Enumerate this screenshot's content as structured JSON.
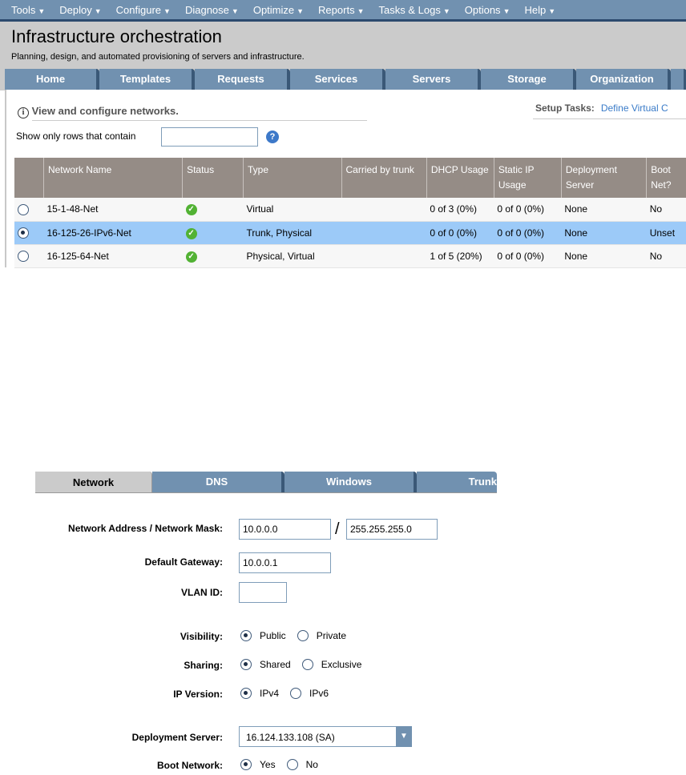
{
  "menu": [
    "Tools",
    "Deploy",
    "Configure",
    "Diagnose",
    "Optimize",
    "Reports",
    "Tasks & Logs",
    "Options",
    "Help"
  ],
  "header": {
    "title": "Infrastructure orchestration",
    "subtitle": "Planning, design, and automated provisioning of servers and infrastructure."
  },
  "main_tabs": [
    "Home",
    "Templates",
    "Requests",
    "Services",
    "Servers",
    "Storage",
    "Organization",
    ""
  ],
  "info": "View and configure networks.",
  "setup": {
    "label": "Setup Tasks:",
    "link": "Define Virtual C"
  },
  "filter": {
    "label": "Show only rows that contain",
    "value": "",
    "help": "?"
  },
  "table": {
    "columns": [
      "",
      "Network Name",
      "Status",
      "Type",
      "Carried by trunk",
      "DHCP Usage",
      "Static IP Usage",
      "Deployment Server",
      "Boot Net?"
    ],
    "rows": [
      {
        "selected": false,
        "name": "15-1-48-Net",
        "status": "ok",
        "type": "Virtual",
        "trunk": "",
        "dhcp": "0 of 3 (0%)",
        "static": "0 of 0 (0%)",
        "server": "None",
        "boot": "No"
      },
      {
        "selected": true,
        "name": "16-125-26-IPv6-Net",
        "status": "ok",
        "type": "Trunk, Physical",
        "trunk": "",
        "dhcp": "0 of 0 (0%)",
        "static": "0 of 0 (0%)",
        "server": "None",
        "boot": "Unset"
      },
      {
        "selected": false,
        "name": "16-125-64-Net",
        "status": "ok",
        "type": "Physical, Virtual",
        "trunk": "",
        "dhcp": "1 of 5 (20%)",
        "static": "0 of 0 (0%)",
        "server": "None",
        "boot": "No"
      }
    ]
  },
  "sub_tabs": [
    "Network",
    "DNS",
    "Windows",
    "Trunk"
  ],
  "form": {
    "address_label": "Network Address / Network Mask:",
    "address": "10.0.0.0",
    "mask": "255.255.255.0",
    "slash": "/",
    "gateway_label": "Default Gateway:",
    "gateway": "10.0.0.1",
    "vlan_label": "VLAN ID:",
    "vlan": "",
    "radios": [
      {
        "label": "Visibility:",
        "options": [
          "Public",
          "Private"
        ],
        "selected": 0
      },
      {
        "label": "Sharing:",
        "options": [
          "Shared",
          "Exclusive"
        ],
        "selected": 0
      },
      {
        "label": "IP Version:",
        "options": [
          "IPv4",
          "IPv6"
        ],
        "selected": 0
      }
    ],
    "deploy_label": "Deployment Server:",
    "deploy_value": "16.124.133.108 (SA)",
    "boot": {
      "label": "Boot Network:",
      "options": [
        "Yes",
        "No"
      ],
      "selected": 0
    }
  },
  "colors": {
    "menu": "#7191b0",
    "header": "#cbcbcb",
    "table_header": "#958c86",
    "selected_row": "#9ccaf8"
  }
}
